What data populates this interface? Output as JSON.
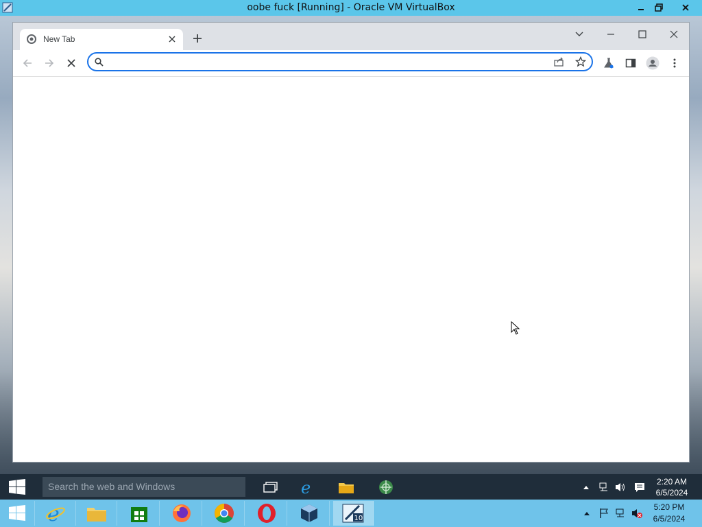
{
  "host": {
    "title": "oobe fuck [Running] - Oracle VM VirtualBox",
    "taskbar": {
      "icons": [
        "start-icon",
        "internet-explorer-icon",
        "file-explorer-icon",
        "store-icon",
        "firefox-icon",
        "chrome-icon",
        "opera-icon",
        "virtualbox-icon",
        "virtualbox-vm-icon"
      ],
      "time": "5:20 PM",
      "date": "6/5/2024"
    }
  },
  "browser": {
    "tab": {
      "label": "New Tab"
    },
    "omnibox": {
      "value": "",
      "placeholder": ""
    }
  },
  "guest": {
    "search": {
      "placeholder": "Search the web and Windows"
    },
    "time": "2:20 AM",
    "date": "6/5/2024"
  },
  "colors": {
    "accent": "#1a73e8",
    "host_bar": "#5bc6ea",
    "guest_taskbar": "#1f2d3a"
  }
}
